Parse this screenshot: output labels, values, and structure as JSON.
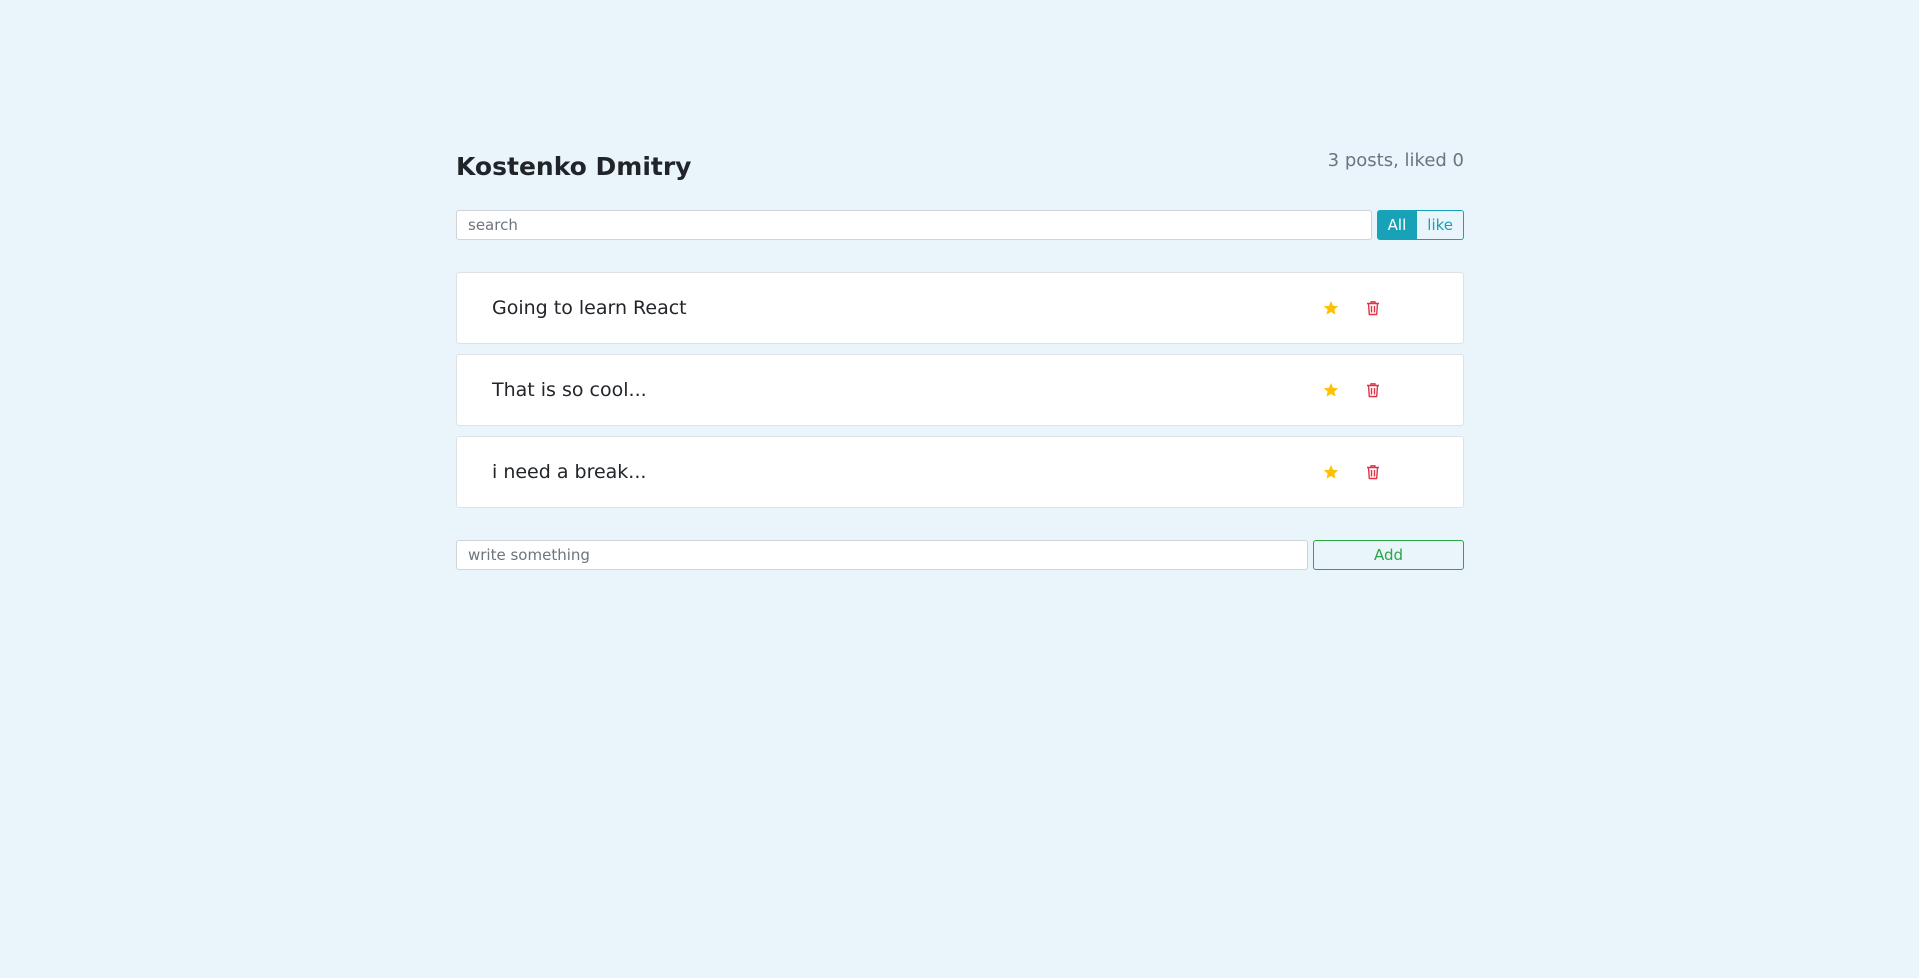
{
  "header": {
    "title": "Kostenko Dmitry",
    "stats": "3 posts, liked 0"
  },
  "search": {
    "placeholder": "search",
    "value": ""
  },
  "filters": [
    {
      "label": "All",
      "active": true
    },
    {
      "label": "like",
      "active": false
    }
  ],
  "posts": [
    {
      "label": "Going to learn React"
    },
    {
      "label": "That is so cool..."
    },
    {
      "label": "i need a break..."
    }
  ],
  "post_actions": {
    "star_icon": "star-icon",
    "trash_icon": "trash-icon",
    "star_color": "#ffc107",
    "trash_color": "#dc3545"
  },
  "add_form": {
    "placeholder": "write something",
    "value": "",
    "button_label": "Add"
  },
  "colors": {
    "background": "#e9f5fb",
    "accent": "#17a2b8",
    "success": "#28a745"
  }
}
